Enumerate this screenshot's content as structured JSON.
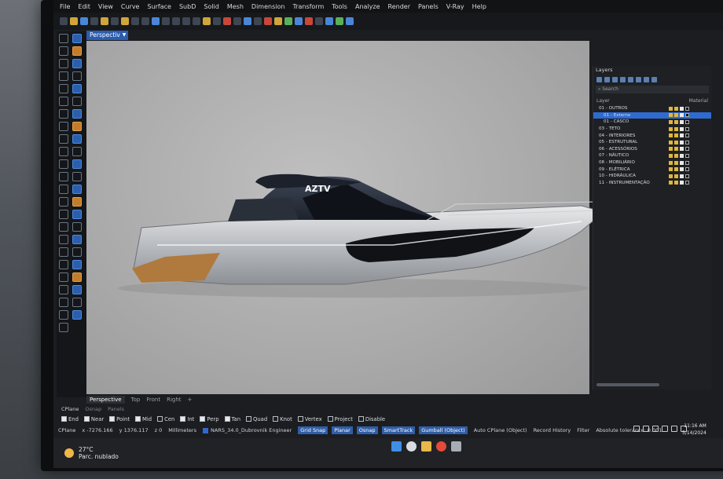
{
  "menu": [
    "File",
    "Edit",
    "View",
    "Curve",
    "Surface",
    "SubD",
    "Solid",
    "Mesh",
    "Dimension",
    "Transform",
    "Tools",
    "Analyze",
    "Render",
    "Panels",
    "V-Ray",
    "Help"
  ],
  "viewport": {
    "active_tab": "Perspective",
    "tabs": [
      "Perspective",
      "Top",
      "Front",
      "Right",
      "+"
    ]
  },
  "boat_logo": "AZTV",
  "layers_panel": {
    "title": "Layers",
    "search_placeholder": "Search",
    "col_layer": "Layer",
    "col_material": "Material",
    "rows": [
      "01 - OUTROS",
      "01 - Externo",
      "01 - CASCO",
      "03 - TETO",
      "04 - INTERIORES",
      "05 - ESTRUTURAL",
      "06 - ACESSÓRIOS",
      "07 - NÁUTICO",
      "08 - MOBILIÁRIO",
      "09 - ELÉTRICA",
      "10 - HIDRÁULICA",
      "11 - INSTRUMENTAÇÃO"
    ],
    "selected_index": 1
  },
  "osnap": {
    "tabs": [
      "CPlane",
      "Osnap",
      "Panels"
    ],
    "items": [
      {
        "label": "End",
        "on": true
      },
      {
        "label": "Near",
        "on": true
      },
      {
        "label": "Point",
        "on": true
      },
      {
        "label": "Mid",
        "on": true
      },
      {
        "label": "Cen",
        "on": false
      },
      {
        "label": "Int",
        "on": true
      },
      {
        "label": "Perp",
        "on": true
      },
      {
        "label": "Tan",
        "on": true
      },
      {
        "label": "Quad",
        "on": false
      },
      {
        "label": "Knot",
        "on": false
      },
      {
        "label": "Vertex",
        "on": false
      },
      {
        "label": "Project",
        "on": false
      },
      {
        "label": "Disable",
        "on": false
      }
    ]
  },
  "status": {
    "cplane": "CPlane",
    "x": "x -7276.166",
    "y": "y 1376.117",
    "z": "z 0",
    "units": "Millimeters",
    "layer": "NARS_34.0_Dubrovnik Engineer",
    "buttons": [
      "Grid Snap",
      "Planar",
      "Osnap",
      "SmartTrack",
      "Gumball (Object)"
    ],
    "extra": [
      "Auto CPlane (Object)",
      "Record History",
      "Filter",
      "Absolute tolerance: 0.001"
    ]
  },
  "taskbar": {
    "temp": "27°C",
    "weather": "Parc. nublado",
    "time": "11:16 AM",
    "date": "5/14/2024"
  }
}
